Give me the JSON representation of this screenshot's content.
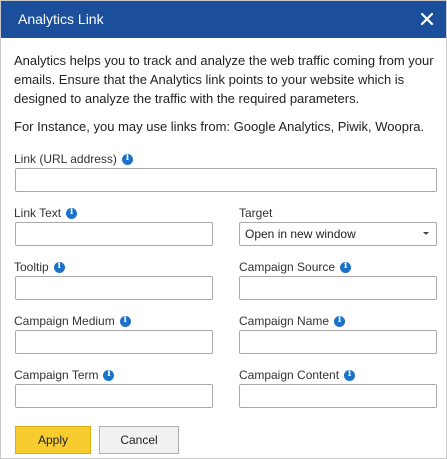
{
  "dialog": {
    "title": "Analytics Link",
    "description": "Analytics helps you to track and analyze the web traffic coming from your emails. Ensure that the Analytics link points to your website which is designed to analyze the traffic with the required parameters.",
    "instance_text": "For Instance, you may use links from: Google Analytics, Piwik, Woopra."
  },
  "fields": {
    "link_url": {
      "label": "Link (URL address)",
      "value": ""
    },
    "link_text": {
      "label": "Link Text",
      "value": ""
    },
    "target": {
      "label": "Target",
      "value": "Open in new window"
    },
    "tooltip": {
      "label": "Tooltip",
      "value": ""
    },
    "campaign_source": {
      "label": "Campaign Source",
      "value": ""
    },
    "campaign_medium": {
      "label": "Campaign Medium",
      "value": ""
    },
    "campaign_name": {
      "label": "Campaign Name",
      "value": ""
    },
    "campaign_term": {
      "label": "Campaign Term",
      "value": ""
    },
    "campaign_content": {
      "label": "Campaign Content",
      "value": ""
    }
  },
  "buttons": {
    "apply": "Apply",
    "cancel": "Cancel"
  },
  "icons": {
    "close": "close-icon",
    "info": "info-icon",
    "dropdown": "chevron-down-icon"
  },
  "colors": {
    "titlebar": "#1b4f9c",
    "apply": "#f7cc2e",
    "info": "#1b72c8"
  }
}
